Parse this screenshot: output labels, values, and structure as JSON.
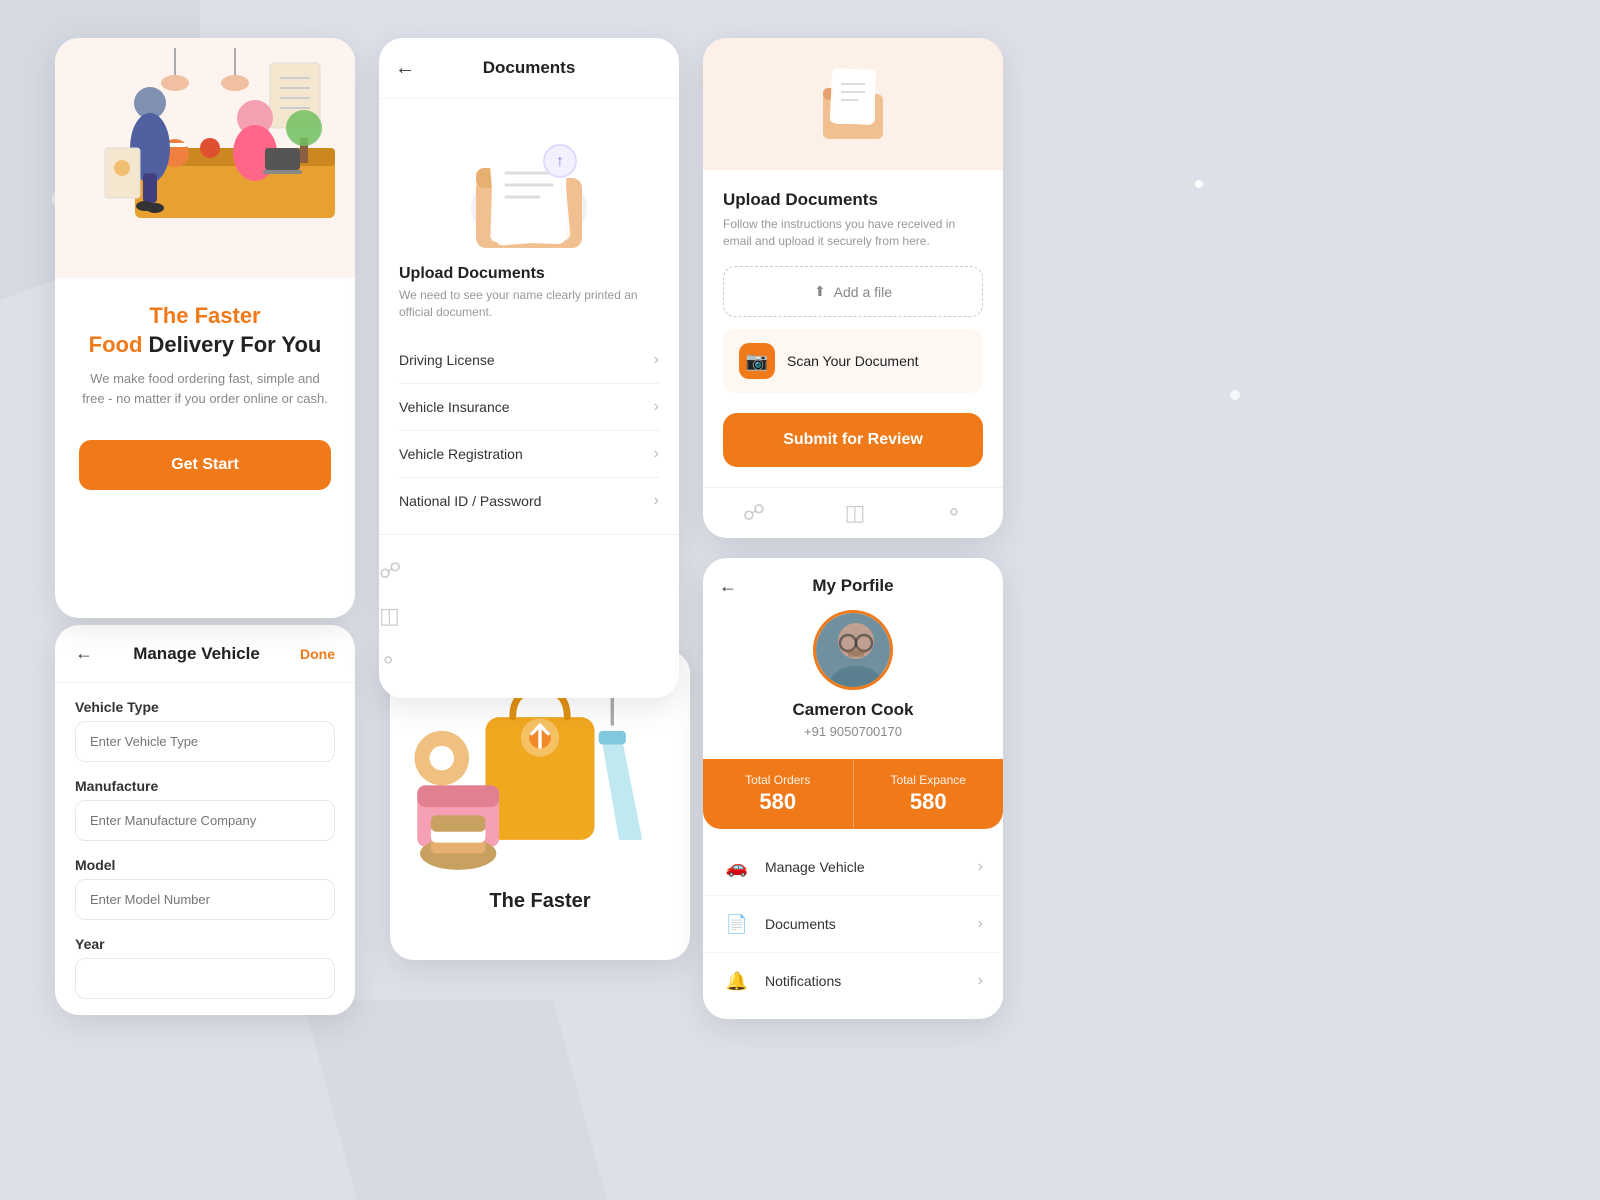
{
  "cards": {
    "food_delivery": {
      "title_line1": "The Faster",
      "title_word_orange": "Food",
      "title_line2": "Delivery For You",
      "description": "We make food ordering fast, simple and free - no matter if you order online or cash.",
      "cta_button": "Get Start"
    },
    "documents": {
      "header": "Documents",
      "back": "←",
      "upload_title": "Upload Documents",
      "upload_desc": "We need  to see your name clearly printed an official document.",
      "items": [
        {
          "label": "Driving License"
        },
        {
          "label": "Vehicle Insurance"
        },
        {
          "label": "Vehicle Registration"
        },
        {
          "label": "National ID / Password"
        }
      ]
    },
    "upload_docs": {
      "upload_title": "Upload Documents",
      "upload_desc": "Follow the instructions you have received in email and upload it securely from here.",
      "add_file_label": "Add a file",
      "scan_label": "Scan Your Document",
      "submit_label": "Submit for Review"
    },
    "profile": {
      "back": "←",
      "title": "My Porfile",
      "name": "Cameron Cook",
      "phone": "+91 9050700170",
      "total_orders_label": "Total Orders",
      "total_orders_value": "580",
      "total_expance_label": "Total Expance",
      "total_expance_value": "580",
      "menu_items": [
        {
          "label": "Manage Vehicle",
          "icon": "🚗"
        },
        {
          "label": "Documents",
          "icon": "📄"
        },
        {
          "label": "Notifications",
          "icon": "🔔"
        }
      ]
    },
    "manage_vehicle": {
      "back": "←",
      "title": "Manage Vehicle",
      "done": "Done",
      "fields": [
        {
          "label": "Vehicle Type",
          "placeholder": "Enter Vehicle Type"
        },
        {
          "label": "Manufacture",
          "placeholder": "Enter Manufacture Company"
        },
        {
          "label": "Model",
          "placeholder": "Enter Model Number"
        },
        {
          "label": "Year",
          "placeholder": ""
        }
      ]
    },
    "food_bottom": {
      "title": "The Faster"
    }
  },
  "icons": {
    "back": "←",
    "chevron_right": "›",
    "upload": "⬆",
    "camera": "📷",
    "document": "📄",
    "wallet": "💳",
    "person": "👤"
  }
}
